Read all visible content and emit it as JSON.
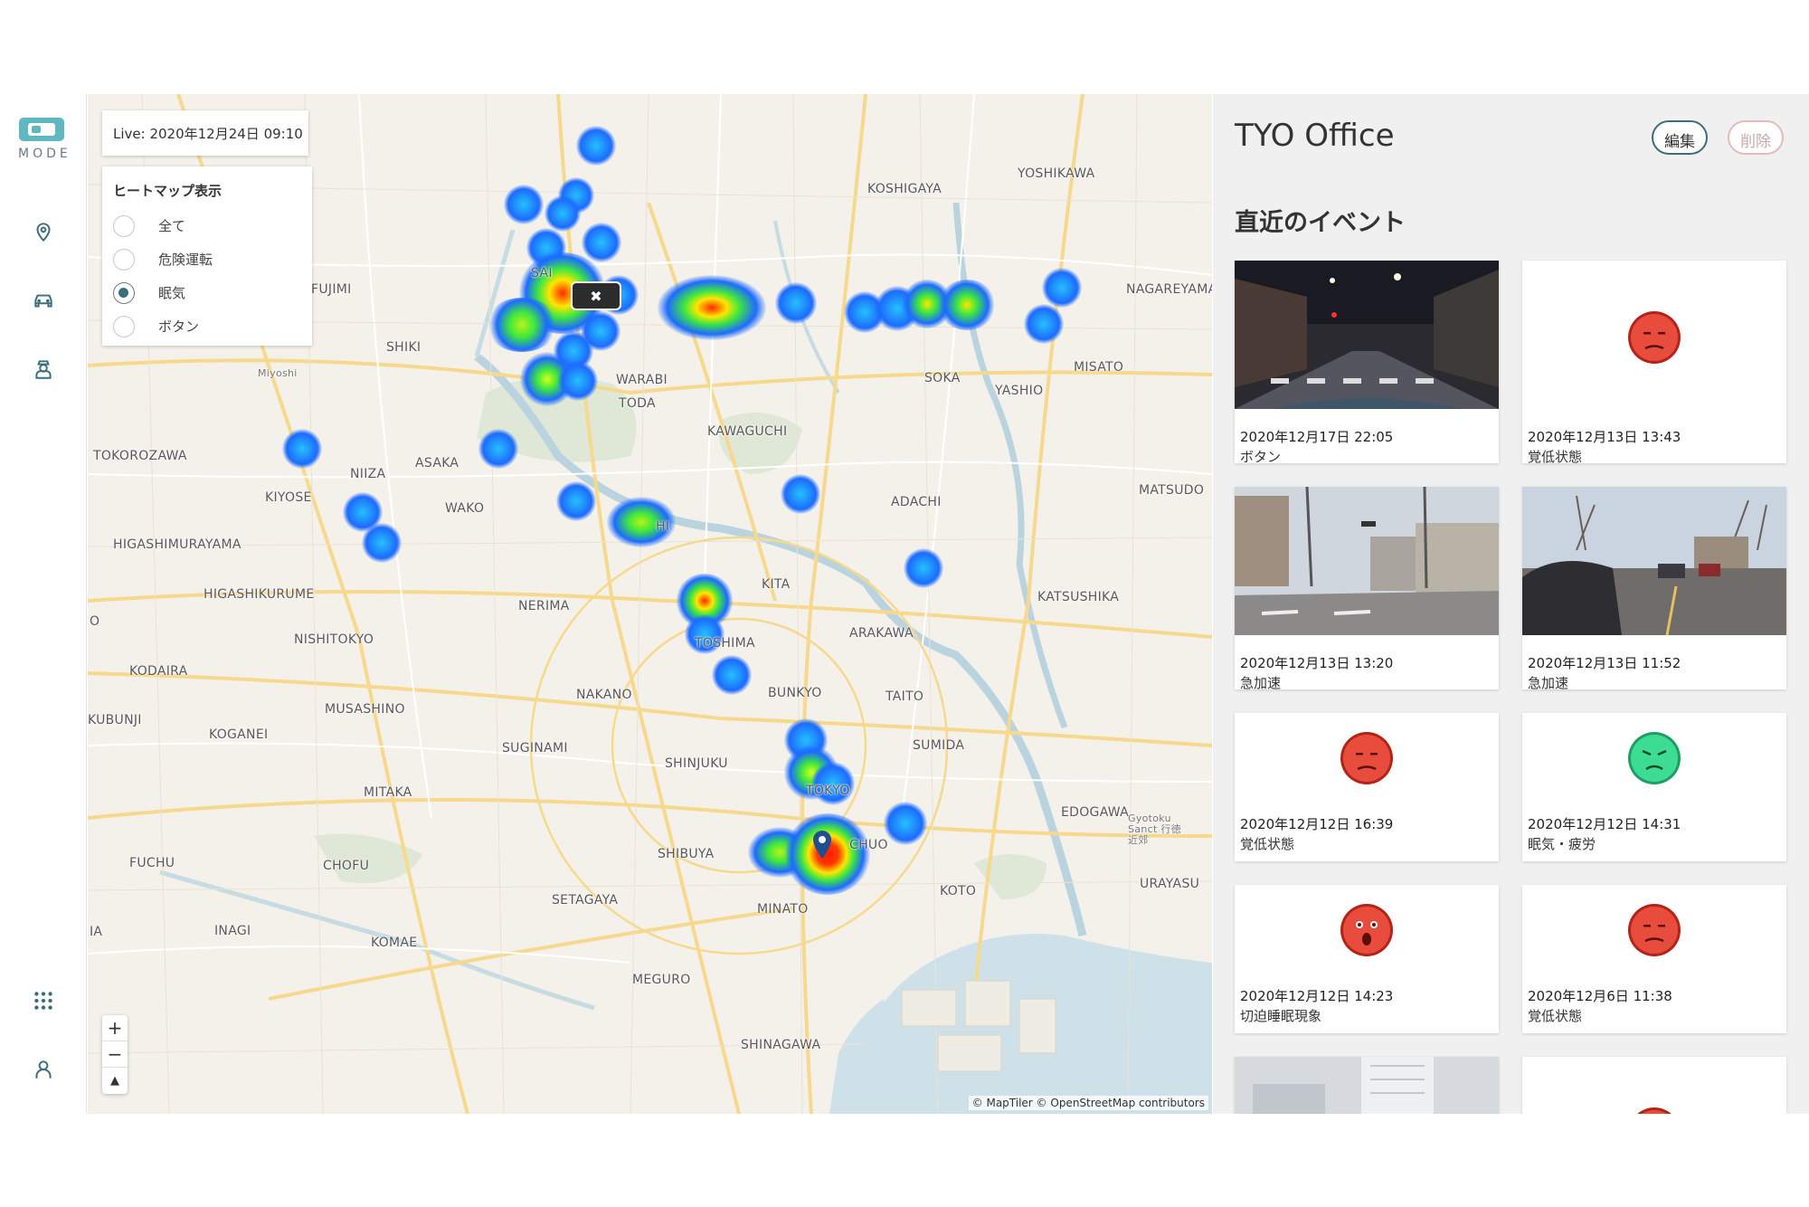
{
  "app": {
    "logo_text": "MODE"
  },
  "nav": {
    "items": [
      {
        "icon": "location-pin-icon"
      },
      {
        "icon": "car-icon"
      },
      {
        "icon": "driver-icon"
      },
      {
        "icon": "grid-icon"
      },
      {
        "icon": "user-icon"
      }
    ]
  },
  "map": {
    "live_label": "Live: 2020年12月24日 09:10",
    "legend": {
      "title": "ヒートマップ表示",
      "options": [
        {
          "label": "全て",
          "checked": false
        },
        {
          "label": "危険運転",
          "checked": false
        },
        {
          "label": "眠気",
          "checked": true
        },
        {
          "label": "ボタン",
          "checked": false
        }
      ]
    },
    "zoom": {
      "in": "+",
      "out": "−",
      "compass": "▲"
    },
    "attribution": "© MapTiler © OpenStreetMap contributors",
    "places": {
      "koshigaya": "KOSHIGAYA",
      "yoshikawa": "YOSHIKAWA",
      "nagareyama": "NAGAREYAMA",
      "fujimi": "FUJIMI",
      "sai": "SAI",
      "shiki": "SHIKI",
      "miyoshi": "Miyoshi",
      "warabi": "WARABI",
      "toda": "TODA",
      "soka": "SOKA",
      "yashio": "YASHIO",
      "misato": "MISATO",
      "kawaguchi": "KAWAGUCHI",
      "tokorozawa": "TOKOROZAWA",
      "asaka": "ASAKA",
      "niiza": "NIIZA",
      "kiyose": "KIYOSE",
      "wako": "WAKO",
      "adachi": "ADACHI",
      "matsudo": "MATSUDO",
      "higashimurayama": "HIGASHIMURAYAMA",
      "higashikurume": "HIGASHIKURUME",
      "kita": "KITA",
      "katsushika": "KATSUSHIKA",
      "nerima": "NERIMA",
      "nishitokyo": "NISHITOKYO",
      "arakawa": "ARAKAWA",
      "kodaira": "KODAIRA",
      "toshima": "TOSHIMA",
      "bunkyo": "BUNKYO",
      "taito": "TAITO",
      "nakano": "NAKANO",
      "musashino": "MUSASHINO",
      "kokubunji": "KUBUNJI",
      "koganei": "KOGANEI",
      "suginami": "SUGINAMI",
      "shinjuku": "SHINJUKU",
      "sumida": "SUMIDA",
      "tokyo": "TOKYO",
      "mitaka": "MITAKA",
      "edogawa": "EDOGAWA",
      "chuo": "CHUO",
      "shibuya": "SHIBUYA",
      "fuchu": "FUCHU",
      "chofu": "CHOFU",
      "urayasu": "URAYASU",
      "koto": "KOTO",
      "minato": "MINATO",
      "setagaya": "SETAGAYA",
      "inagi": "INAGI",
      "komae": "KOMAE",
      "meguro": "MEGURO",
      "shinagawa": "SHINAGAWA",
      "hi": "HI",
      "o": "O",
      "ia": "IA",
      "gyotoku": "Gyotoku Sanct 行徳近郊"
    }
  },
  "panel": {
    "title": "TYO Office",
    "edit_label": "編集",
    "delete_label": "削除",
    "section_title": "直近のイベント",
    "events": [
      {
        "date": "2020年12月17日 22:05",
        "type": "ボタン",
        "media": "night-street-photo"
      },
      {
        "date": "2020年12月13日 13:43",
        "type": "覚低状態",
        "media": "red-sad-face-icon"
      },
      {
        "date": "2020年12月13日 13:20",
        "type": "急加速",
        "media": "day-intersection-photo"
      },
      {
        "date": "2020年12月13日 11:52",
        "type": "急加速",
        "media": "day-road-cars-photo"
      },
      {
        "date": "2020年12月12日 16:39",
        "type": "覚低状態",
        "media": "red-sad-face-icon"
      },
      {
        "date": "2020年12月12日 14:31",
        "type": "眠気・疲労",
        "media": "green-tired-face-icon"
      },
      {
        "date": "2020年12月12日 14:23",
        "type": "切迫睡眠現象",
        "media": "red-shocked-face-icon"
      },
      {
        "date": "2020年12月6日 11:38",
        "type": "覚低状態",
        "media": "red-sad-face-icon"
      }
    ]
  }
}
